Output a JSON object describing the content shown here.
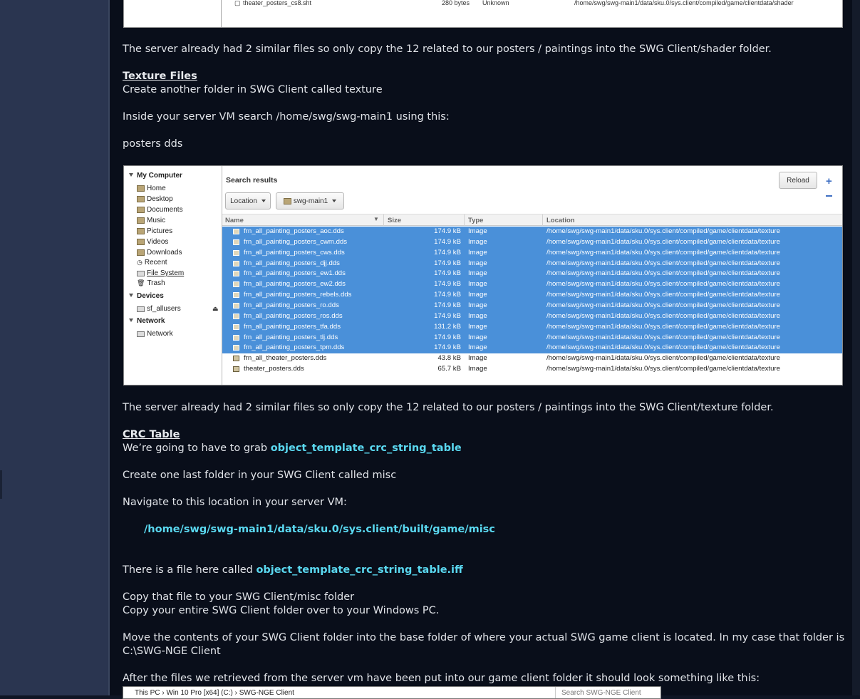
{
  "top_screenshot": {
    "file_name": "theater_posters_cs8.sht",
    "size": "280 bytes",
    "type": "Unknown",
    "location": "/home/swg/swg-main1/data/sku.0/sys.client/compiled/game/clientdata/shader"
  },
  "paragraphs": {
    "shader_note": "The server already had 2 similar files so only copy the 12 related to our posters / paintings into the SWG Client/shader folder.",
    "texture_heading": "Texture Files",
    "texture_create": "Create another folder in SWG Client called texture",
    "texture_search": "Inside your server VM search /home/swg/swg-main1 using this:",
    "texture_query": "posters dds",
    "texture_note": "The server already had 2 similar files so only copy the 12 related to our posters / paintings into the SWG Client/texture folder.",
    "crc_heading": "CRC Table",
    "crc_grab_prefix": "We’re going to have to grab ",
    "crc_grab_file": "object_template_crc_string_table",
    "crc_create": "Create one last folder in your SWG Client called misc",
    "crc_navigate": "Navigate to this location in your server VM:",
    "crc_path": "/home/swg/swg-main1/data/sku.0/sys.client/built/game/misc",
    "crc_file_prefix": "There is a file here called ",
    "crc_file": "object_template_crc_string_table.iff",
    "copy_misc": "Copy that file to your SWG Client/misc folder",
    "copy_entire": "Copy your entire SWG Client folder over to your Windows PC.",
    "move_line1": "Move the contents of your SWG Client folder into the base folder of where your actual SWG game client is located. In my case that folder is",
    "move_line2": "C:\\SWG-NGE Client",
    "after_files": "After the files we retrieved from the server vm have been put into our game client folder it should look something like this:"
  },
  "file_manager": {
    "sidebar": {
      "my_computer": "My Computer",
      "places": [
        "Home",
        "Desktop",
        "Documents",
        "Music",
        "Pictures",
        "Videos",
        "Downloads",
        "Recent",
        "File System",
        "Trash"
      ],
      "devices": "Devices",
      "device_items": [
        "sf_allusers"
      ],
      "network": "Network",
      "network_items": [
        "Network"
      ]
    },
    "title": "Search results",
    "reload": "Reload",
    "location_button": "Location",
    "folder_button": "swg-main1",
    "columns": {
      "name": "Name",
      "size": "Size",
      "type": "Type",
      "location": "Location"
    },
    "rows": [
      {
        "name": "frn_all_painting_posters_aoc.dds",
        "size": "174.9 kB",
        "type": "Image",
        "location": "/home/swg/swg-main1/data/sku.0/sys.client/compiled/game/clientdata/texture",
        "selected": true
      },
      {
        "name": "frn_all_painting_posters_cwm.dds",
        "size": "174.9 kB",
        "type": "Image",
        "location": "/home/swg/swg-main1/data/sku.0/sys.client/compiled/game/clientdata/texture",
        "selected": true
      },
      {
        "name": "frn_all_painting_posters_cws.dds",
        "size": "174.9 kB",
        "type": "Image",
        "location": "/home/swg/swg-main1/data/sku.0/sys.client/compiled/game/clientdata/texture",
        "selected": true
      },
      {
        "name": "frn_all_painting_posters_djj.dds",
        "size": "174.9 kB",
        "type": "Image",
        "location": "/home/swg/swg-main1/data/sku.0/sys.client/compiled/game/clientdata/texture",
        "selected": true
      },
      {
        "name": "frn_all_painting_posters_ew1.dds",
        "size": "174.9 kB",
        "type": "Image",
        "location": "/home/swg/swg-main1/data/sku.0/sys.client/compiled/game/clientdata/texture",
        "selected": true
      },
      {
        "name": "frn_all_painting_posters_ew2.dds",
        "size": "174.9 kB",
        "type": "Image",
        "location": "/home/swg/swg-main1/data/sku.0/sys.client/compiled/game/clientdata/texture",
        "selected": true
      },
      {
        "name": "frn_all_painting_posters_rebels.dds",
        "size": "174.9 kB",
        "type": "Image",
        "location": "/home/swg/swg-main1/data/sku.0/sys.client/compiled/game/clientdata/texture",
        "selected": true
      },
      {
        "name": "frn_all_painting_posters_ro.dds",
        "size": "174.9 kB",
        "type": "Image",
        "location": "/home/swg/swg-main1/data/sku.0/sys.client/compiled/game/clientdata/texture",
        "selected": true
      },
      {
        "name": "frn_all_painting_posters_ros.dds",
        "size": "174.9 kB",
        "type": "Image",
        "location": "/home/swg/swg-main1/data/sku.0/sys.client/compiled/game/clientdata/texture",
        "selected": true
      },
      {
        "name": "frn_all_painting_posters_tfa.dds",
        "size": "131.2 kB",
        "type": "Image",
        "location": "/home/swg/swg-main1/data/sku.0/sys.client/compiled/game/clientdata/texture",
        "selected": true
      },
      {
        "name": "frn_all_painting_posters_tlj.dds",
        "size": "174.9 kB",
        "type": "Image",
        "location": "/home/swg/swg-main1/data/sku.0/sys.client/compiled/game/clientdata/texture",
        "selected": true
      },
      {
        "name": "frn_all_painting_posters_tpm.dds",
        "size": "174.9 kB",
        "type": "Image",
        "location": "/home/swg/swg-main1/data/sku.0/sys.client/compiled/game/clientdata/texture",
        "selected": true
      },
      {
        "name": "frn_all_theater_posters.dds",
        "size": "43.8 kB",
        "type": "Image",
        "location": "/home/swg/swg-main1/data/sku.0/sys.client/compiled/game/clientdata/texture",
        "selected": false
      },
      {
        "name": "theater_posters.dds",
        "size": "65.7 kB",
        "type": "Image",
        "location": "/home/swg/swg-main1/data/sku.0/sys.client/compiled/game/clientdata/texture",
        "selected": false
      }
    ]
  },
  "explorer": {
    "breadcrumb": "This PC  ›  Win 10 Pro [x64] (C:)  ›  SWG-NGE Client",
    "search_placeholder": "Search SWG-NGE Client"
  },
  "colors": {
    "highlight": "#5ad8f0",
    "selection": "#4a90d9",
    "background": "#090e1a"
  }
}
